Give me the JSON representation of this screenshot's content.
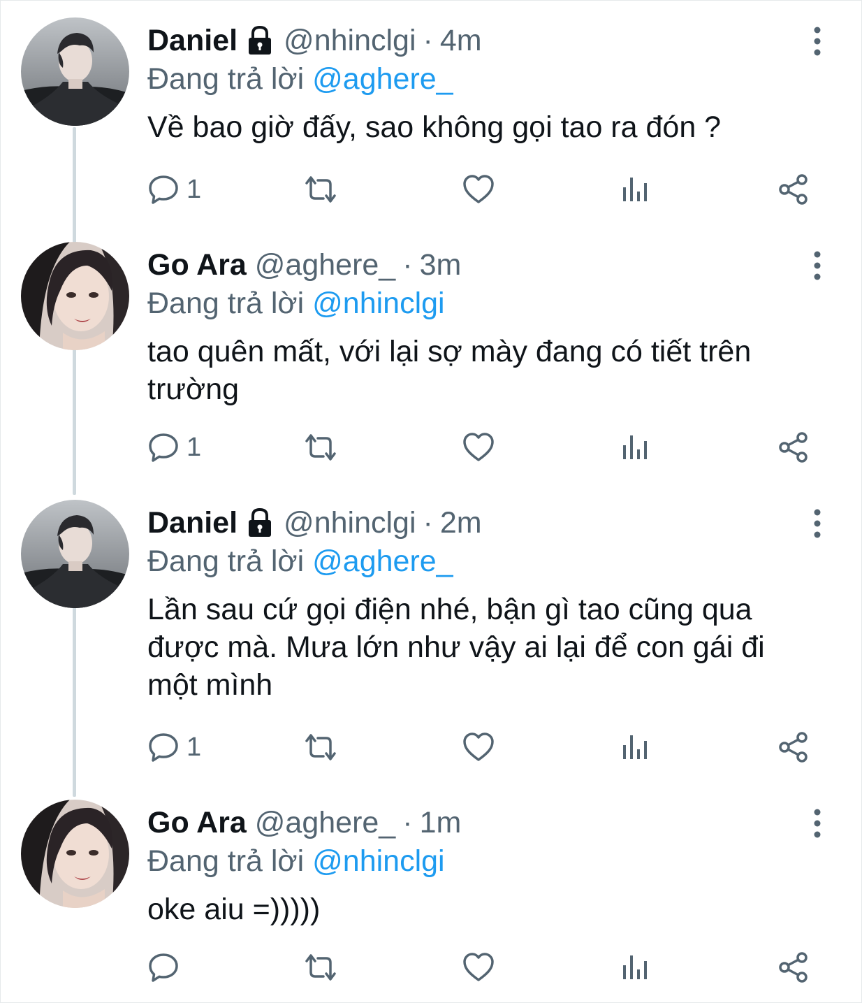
{
  "reply_prefix": "Đang trả lời",
  "tweets": [
    {
      "name": "Daniel",
      "handle": "@nhinclgi",
      "separator": "·",
      "time": "4m",
      "reply_to": "@aghere_",
      "text": "Về bao giờ đấy, sao không gọi tao ra đón ?",
      "reply_count": "1",
      "avatar": "male-avatar"
    },
    {
      "name": "Go Ara",
      "handle": "@aghere_",
      "separator": "·",
      "time": "3m",
      "reply_to": "@nhinclgi",
      "text": "tao quên mất, với lại sợ mày đang có tiết trên trường",
      "reply_count": "1",
      "avatar": "female-avatar"
    },
    {
      "name": "Daniel",
      "handle": "@nhinclgi",
      "separator": "·",
      "time": "2m",
      "reply_to": "@aghere_",
      "text": "Lần sau cứ gọi điện nhé, bận gì tao cũng qua được mà. Mưa lớn như vậy ai lại để con gái đi một mình",
      "reply_count": "1",
      "avatar": "male-avatar"
    },
    {
      "name": "Go Ara",
      "handle": "@aghere_",
      "separator": "·",
      "time": "1m",
      "reply_to": "@nhinclgi",
      "text": "oke aiu =)))))",
      "reply_count": "",
      "avatar": "female-avatar"
    }
  ],
  "icons": {
    "reply": "reply-icon",
    "retweet": "retweet-icon",
    "like": "like-icon",
    "views": "views-icon",
    "share": "share-icon",
    "more": "more-icon",
    "lock": "lock-icon"
  },
  "colors": {
    "text": "#0f1419",
    "secondary": "#536471",
    "mention": "#1d9bf0",
    "thread_line": "#cfd9de"
  }
}
